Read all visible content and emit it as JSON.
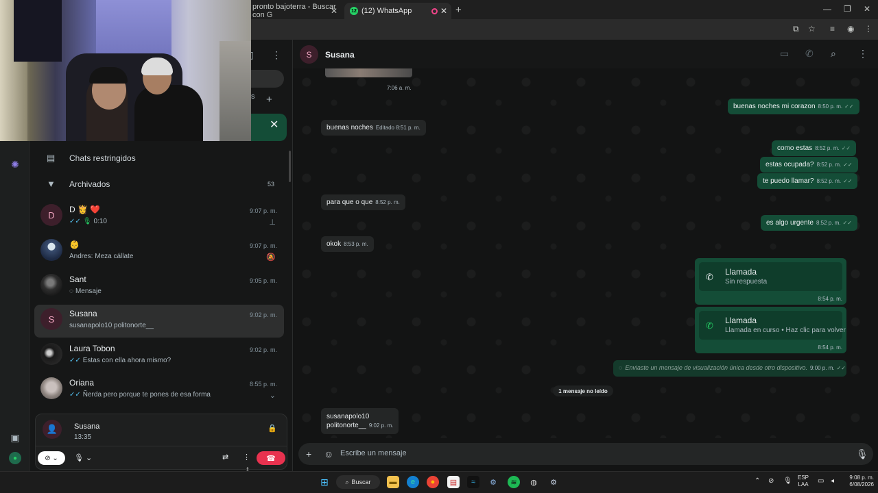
{
  "browser": {
    "tabs": [
      {
        "label": "pronto bajoterra - Buscar con G"
      },
      {
        "label": "(12) WhatsApp",
        "badge": "12"
      }
    ],
    "new_tab": "+"
  },
  "chat_list": {
    "restricted": "Chats restringidos",
    "archived": "Archivados",
    "archived_count": "53",
    "chats": [
      {
        "name": "D 👸 ❤️",
        "time": "9:07 p. m.",
        "preview": "0:10",
        "pinned": true,
        "avatar": "D"
      },
      {
        "name": "👶",
        "time": "9:07 p. m.",
        "preview": "Andres: Meza cállate",
        "muted": true
      },
      {
        "name": "Sant",
        "time": "9:05 p. m.",
        "preview": "Mensaje"
      },
      {
        "name": "Susana",
        "time": "9:02 p. m.",
        "preview": "susanapolo10 politonorte__",
        "avatar": "S",
        "selected": true
      },
      {
        "name": "Laura Tobon",
        "time": "9:02 p. m.",
        "preview": "Estas con ella ahora mismo?"
      },
      {
        "name": "Oriana",
        "time": "8:55 p. m.",
        "preview": "Ñerda pero porque te pones de esa forma"
      }
    ]
  },
  "call": {
    "name": "Susana",
    "duration": "13:35"
  },
  "conversation": {
    "contact": "Susana",
    "avatar": "S",
    "messages": [
      {
        "dir": "in",
        "text": "",
        "time": "7:06 a. m."
      },
      {
        "dir": "out",
        "text": "buenas noches mi corazon",
        "time": "8:50 p. m."
      },
      {
        "dir": "in",
        "text": "buenas noches",
        "time": "8:51 p. m.",
        "edited": "Editado"
      },
      {
        "dir": "out",
        "text": "como estas",
        "time": "8:52 p. m."
      },
      {
        "dir": "out",
        "text": "estas ocupada?",
        "time": "8:52 p. m."
      },
      {
        "dir": "out",
        "text": "te puedo llamar?",
        "time": "8:52 p. m."
      },
      {
        "dir": "in",
        "text": "para que o que",
        "time": "8:52 p. m."
      },
      {
        "dir": "out",
        "text": "es algo urgente",
        "time": "8:52 p. m."
      },
      {
        "dir": "in",
        "text": "okok",
        "time": "8:53 p. m."
      }
    ],
    "calls": [
      {
        "title": "Llamada",
        "subtitle": "Sin respuesta",
        "time": "8:54 p. m."
      },
      {
        "title": "Llamada",
        "subtitle": "Llamada en curso • Haz clic para volver",
        "time": "8:54 p. m."
      }
    ],
    "view_once": {
      "text": "Enviaste un mensaje de visualización única desde otro dispositivo.",
      "time": "9:00 p. m."
    },
    "unread_divider": "1 mensaje no leído",
    "last_message": {
      "line1": "susanapolo10",
      "line2": "politonorte__",
      "time": "9:02 p. m."
    },
    "composer_placeholder": "Escribe un mensaje"
  },
  "taskbar": {
    "search": "Buscar",
    "lang_line1": "ESP",
    "lang_line2": "LAA",
    "time": "9:08 p. m.",
    "date": "6/08/2026"
  }
}
